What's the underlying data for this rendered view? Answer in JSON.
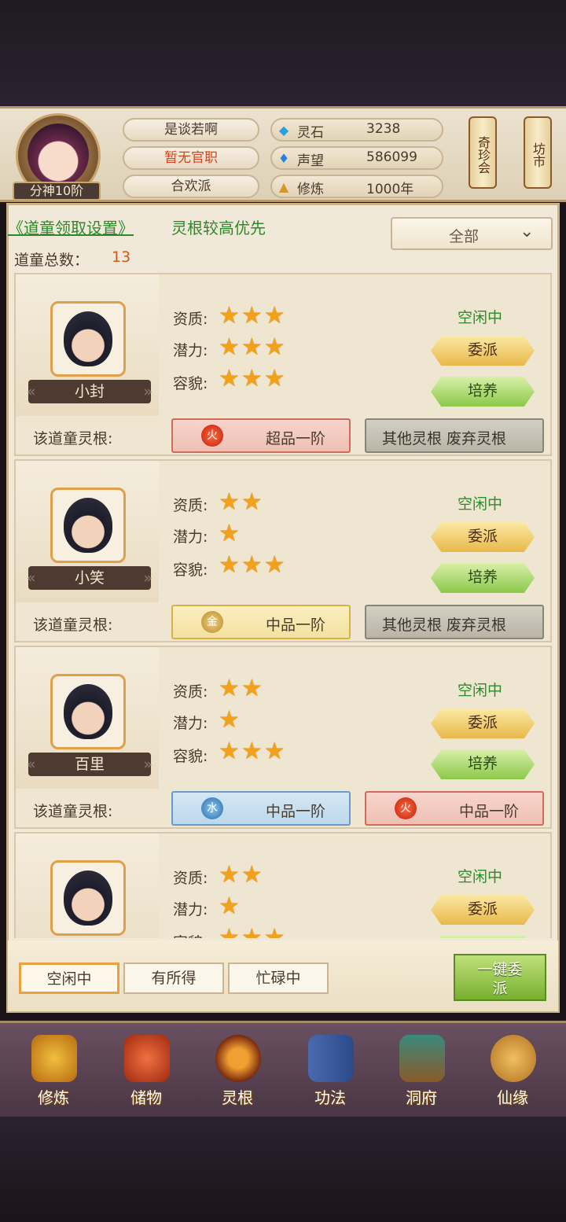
{
  "header": {
    "rank": "分神10阶",
    "name": "是谈若啊",
    "office": "暂无官职",
    "sect": "合欢派",
    "stats": [
      {
        "icon": "spirit-stone-icon",
        "label": "灵石",
        "value": "3238"
      },
      {
        "icon": "reputation-icon",
        "label": "声望",
        "value": "586099"
      },
      {
        "icon": "cultivation-icon",
        "label": "修炼",
        "value": "1000年"
      }
    ],
    "shop1": "奇珍会",
    "shop2": "坊市"
  },
  "settings": {
    "link": "《道童领取设置》",
    "priority": "灵根较高优先",
    "filter": "全部",
    "total_label": "道童总数：",
    "total_value": "13"
  },
  "labels": {
    "quality": "资质:",
    "potential": "潜力:",
    "looks": "容貌:",
    "root": "该道童灵根:",
    "assign": "委派",
    "train": "培养"
  },
  "children": [
    {
      "name": "小封",
      "status": "空闲中",
      "quality": "★★★",
      "potential": "★★★",
      "looks": "★★★",
      "root1": {
        "element": "火",
        "text": "超品一阶"
      },
      "root2": {
        "element": "",
        "text": "其他灵根 废弃灵根"
      }
    },
    {
      "name": "小笑",
      "status": "空闲中",
      "quality": "★★",
      "potential": "★",
      "looks": "★★★",
      "root1": {
        "element": "金",
        "text": "中品一阶"
      },
      "root2": {
        "element": "",
        "text": "其他灵根 废弃灵根"
      }
    },
    {
      "name": "百里",
      "status": "空闲中",
      "quality": "★★",
      "potential": "★",
      "looks": "★★★",
      "root1": {
        "element": "水",
        "text": "中品一阶"
      },
      "root2": {
        "element": "火",
        "text": "中品一阶"
      }
    },
    {
      "name": "",
      "status": "空闲中",
      "quality": "★★",
      "potential": "★",
      "looks": "★★★"
    }
  ],
  "tabs": [
    "空闲中",
    "有所得",
    "忙碌中"
  ],
  "assign_all": "一键委派",
  "nav": [
    {
      "label": "修炼",
      "icon": "meditation-icon"
    },
    {
      "label": "储物",
      "icon": "storage-bag-icon"
    },
    {
      "label": "灵根",
      "icon": "spirit-root-icon"
    },
    {
      "label": "功法",
      "icon": "scripture-book-icon"
    },
    {
      "label": "洞府",
      "icon": "cave-mansion-icon"
    },
    {
      "label": "仙缘",
      "icon": "gourd-icon"
    }
  ]
}
